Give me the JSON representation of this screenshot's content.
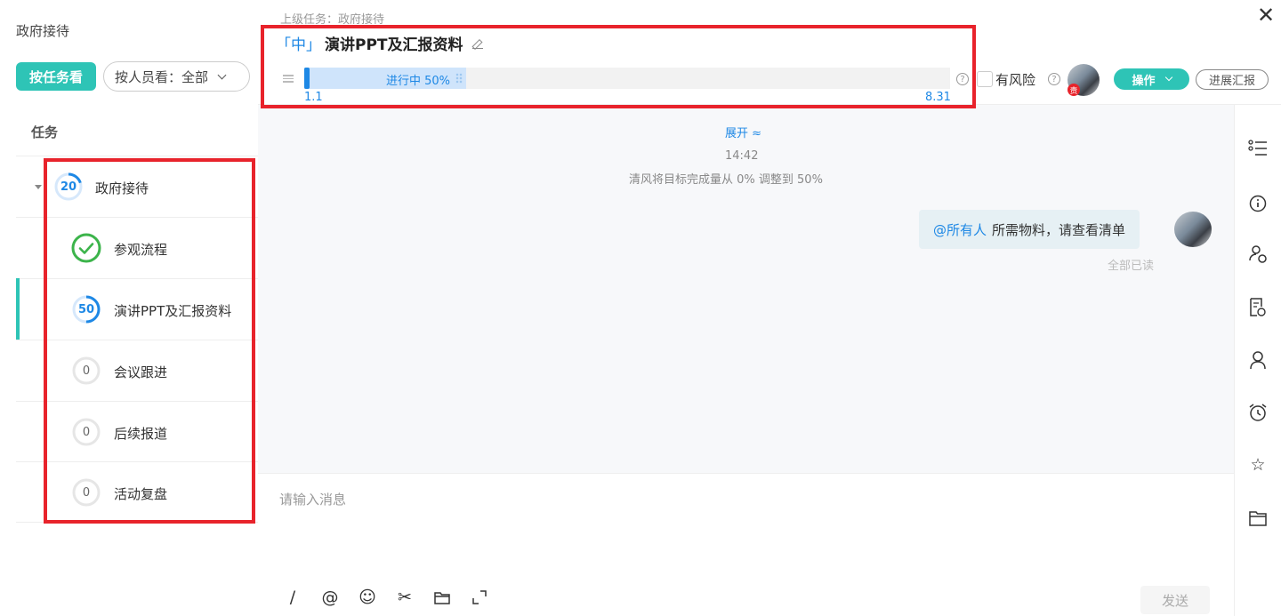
{
  "left": {
    "title": "政府接待",
    "view_by_task": "按任务看",
    "view_by_person": "按人员看：全部",
    "column_header": "任务",
    "tasks": [
      {
        "label": "政府接待",
        "progress": 20,
        "progress_label": "20",
        "status": "in-progress",
        "level": 0
      },
      {
        "label": "参观流程",
        "progress": 100,
        "progress_label": "",
        "status": "done",
        "level": 1
      },
      {
        "label": "演讲PPT及汇报资料",
        "progress": 50,
        "progress_label": "50",
        "status": "in-progress",
        "level": 1,
        "active": true
      },
      {
        "label": "会议跟进",
        "progress": 0,
        "progress_label": "0",
        "status": "not-started",
        "level": 1
      },
      {
        "label": "后续报道",
        "progress": 0,
        "progress_label": "0",
        "status": "not-started",
        "level": 1
      },
      {
        "label": "活动复盘",
        "progress": 0,
        "progress_label": "0",
        "status": "not-started",
        "level": 1
      }
    ]
  },
  "header": {
    "parent_task": "上级任务：政府接待",
    "priority": "「中」",
    "title": "演讲PPT及汇报资料",
    "progress": 0.5,
    "progress_text": "进行中 50%",
    "start_date": "1.1",
    "end_date": "8.31",
    "risk_label": "有风险",
    "owner_tag": "责",
    "operate_label": "操作",
    "report_label": "进展汇报",
    "close_icon": "close-icon"
  },
  "chat": {
    "expand_label": "展开 ≈",
    "time": "14:42",
    "system_message": "清风将目标完成量从 0% 调整到 50%",
    "mention": "@所有人",
    "message": "所需物料，请查看清单",
    "read_status": "全部已读"
  },
  "composer": {
    "placeholder": "请输入消息",
    "send_label": "发送",
    "tools": [
      "slash-icon",
      "at-icon",
      "emoji-icon",
      "scissors-icon",
      "folder-icon",
      "expand-icon"
    ]
  },
  "rightbar": {
    "icons": [
      "list-icon",
      "info-icon",
      "member-settings-icon",
      "document-clock-icon",
      "person-icon",
      "alarm-icon",
      "star-icon",
      "folder-icon"
    ]
  },
  "colors": {
    "accent": "#2ec4b6",
    "blue": "#1e88e5",
    "highlight": "#e8232b",
    "done": "#3cb44b"
  }
}
